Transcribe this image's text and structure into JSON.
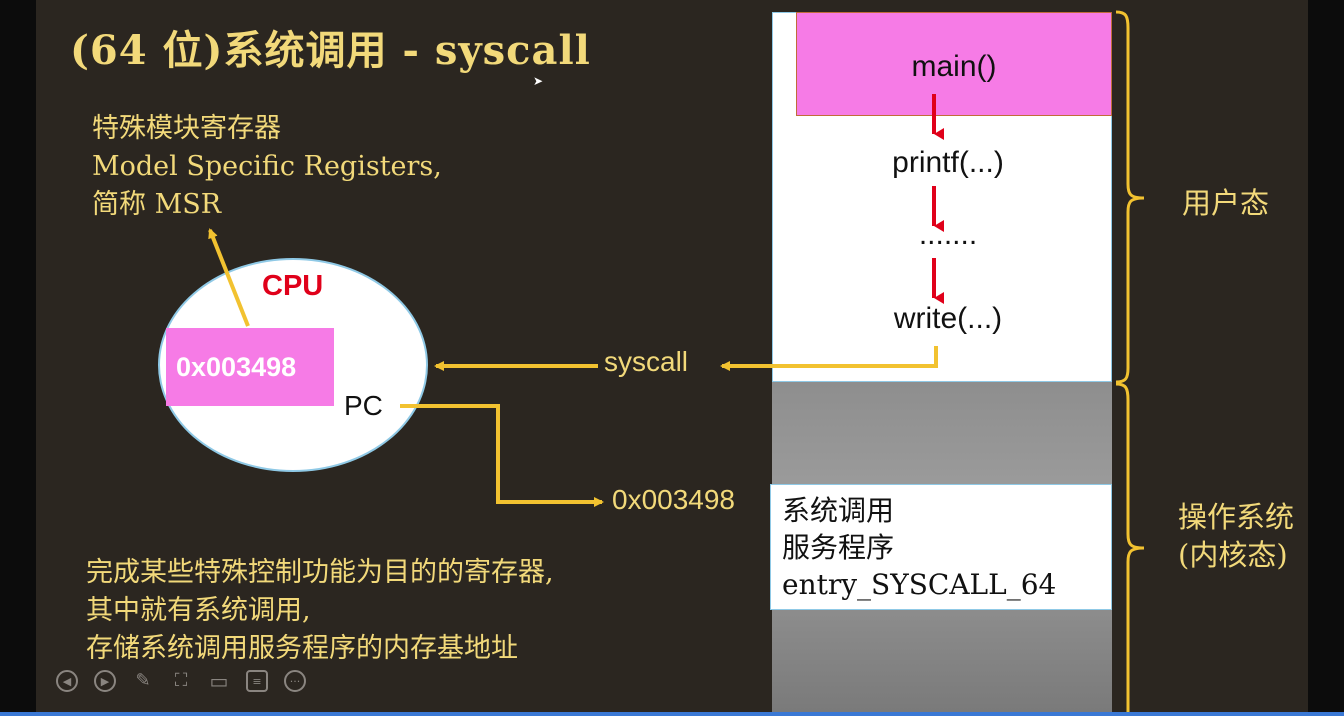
{
  "slide": {
    "title": "(64 位)系统调用 - syscall",
    "msr": {
      "line1": "特殊模块寄存器",
      "line2": "Model Specific Registers,",
      "line3": "简称 MSR"
    },
    "cpu": {
      "label": "CPU",
      "msr_value": "0x003498",
      "pc_label": "PC"
    },
    "syscall_label": "syscall",
    "address_label": "0x003498",
    "user_stack": [
      "main()",
      "printf(...)",
      ".......",
      "write(...)"
    ],
    "service": {
      "line1": "系统调用",
      "line2": "服务程序",
      "line3": "entry_SYSCALL_64"
    },
    "modes": {
      "user": "用户态",
      "kernel_line1": "操作系统",
      "kernel_line2": "(内核态)"
    },
    "description": {
      "line1": "完成某些特殊控制功能为目的的寄存器,",
      "line2": "其中就有系统调用,",
      "line3": "存储系统调用服务程序的内存基地址"
    }
  },
  "toolbar": [
    {
      "icon": "prev-icon",
      "glyph": "◀"
    },
    {
      "icon": "next-icon",
      "glyph": "▶"
    },
    {
      "icon": "pen-icon",
      "glyph": "✎"
    },
    {
      "icon": "focus-icon",
      "glyph": "⛶"
    },
    {
      "icon": "camera-icon",
      "glyph": "▭"
    },
    {
      "icon": "subtitle-icon",
      "glyph": "≡"
    },
    {
      "icon": "more-icon",
      "glyph": "···"
    }
  ],
  "colors": {
    "background": "#2b2620",
    "text_yellow": "#f2d97a",
    "magenta": "#f67be6",
    "red": "#e0001a",
    "arrow_yellow": "#f2c230"
  }
}
